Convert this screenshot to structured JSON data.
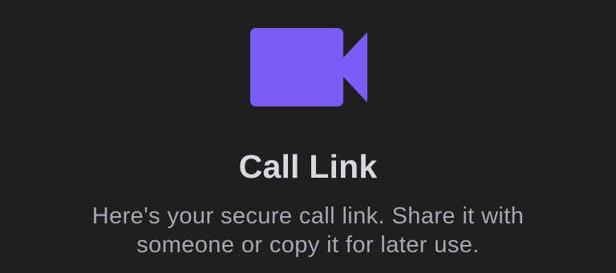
{
  "call_link": {
    "icon": "video-camera-icon",
    "icon_color": "#7b5cf5",
    "title": "Call Link",
    "description_line_1": "Here's your secure call link. Share it with",
    "description_line_2": "someone or copy it for later use."
  },
  "colors": {
    "background": "#1f1e21",
    "title": "#d9d8dc",
    "description": "#a9a8ad"
  }
}
